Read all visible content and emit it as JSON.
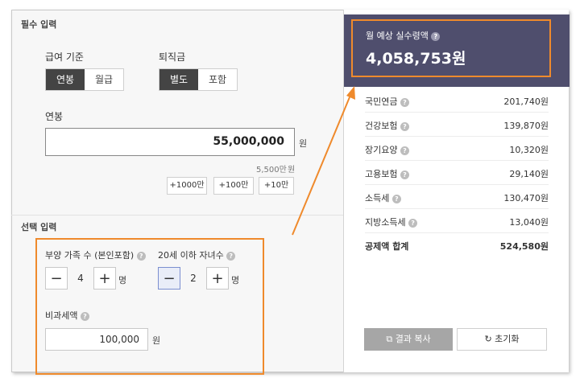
{
  "required": {
    "title": "필수 입력",
    "pay_basis": {
      "label": "급여 기준",
      "options": [
        "연봉",
        "월급"
      ],
      "selected": 0
    },
    "severance": {
      "label": "퇴직금",
      "options": [
        "별도",
        "포함"
      ],
      "selected": 0
    },
    "salary": {
      "label": "연봉",
      "value": "55,000,000",
      "unit": "원",
      "hint_amount": "5,500만",
      "hint_unit": "원"
    },
    "add_buttons": [
      "+1000만",
      "+100만",
      "+10만"
    ]
  },
  "optional": {
    "title": "선택 입력",
    "dependents": {
      "label": "부양 가족 수 (본인포함)",
      "value": "4",
      "unit": "명"
    },
    "children": {
      "label": "20세 이하 자녀수",
      "value": "2",
      "unit": "명"
    },
    "nontaxable": {
      "label": "비과세액",
      "value": "100,000",
      "unit": "원"
    }
  },
  "result": {
    "title": "월 예상 실수령액",
    "amount": "4,058,753원",
    "deductions": [
      {
        "name": "국민연금",
        "value": "201,740원",
        "help": true
      },
      {
        "name": "건강보험",
        "value": "139,870원",
        "help": true
      },
      {
        "name": "장기요양",
        "value": "10,320원",
        "help": true
      },
      {
        "name": "고용보험",
        "value": "29,140원",
        "help": true
      },
      {
        "name": "소득세",
        "value": "130,470원",
        "help": true
      },
      {
        "name": "지방소득세",
        "value": "13,040원",
        "help": true
      }
    ],
    "total": {
      "name": "공제액 합계",
      "value": "524,580원"
    },
    "copy_label": "결과 복사",
    "reset_label": "초기화"
  },
  "colors": {
    "accent_orange": "#ef8a2c",
    "header_bg": "#4f4e6d",
    "selected_bg": "#444444"
  }
}
